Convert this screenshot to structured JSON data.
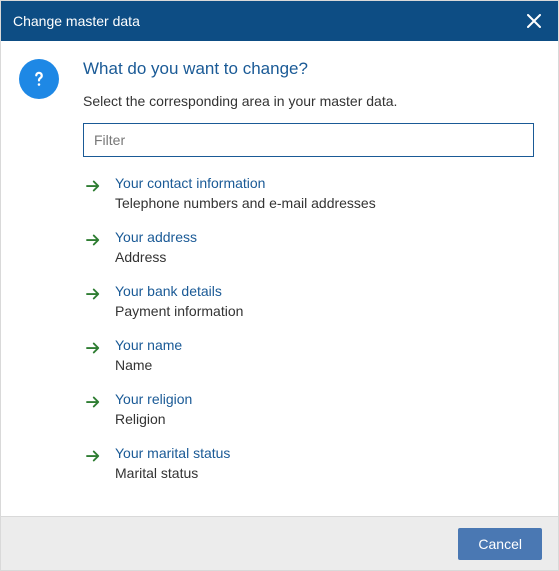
{
  "dialog": {
    "title": "Change master data",
    "heading": "What do you want to change?",
    "instruction": "Select the corresponding area in your master data.",
    "filter_placeholder": "Filter",
    "cancel_label": "Cancel"
  },
  "options": [
    {
      "title": "Your contact information",
      "subtitle": "Telephone numbers and e-mail addresses"
    },
    {
      "title": "Your address",
      "subtitle": "Address"
    },
    {
      "title": "Your bank details",
      "subtitle": "Payment information"
    },
    {
      "title": "Your name",
      "subtitle": "Name"
    },
    {
      "title": "Your religion",
      "subtitle": "Religion"
    },
    {
      "title": "Your marital status",
      "subtitle": "Marital status"
    }
  ]
}
